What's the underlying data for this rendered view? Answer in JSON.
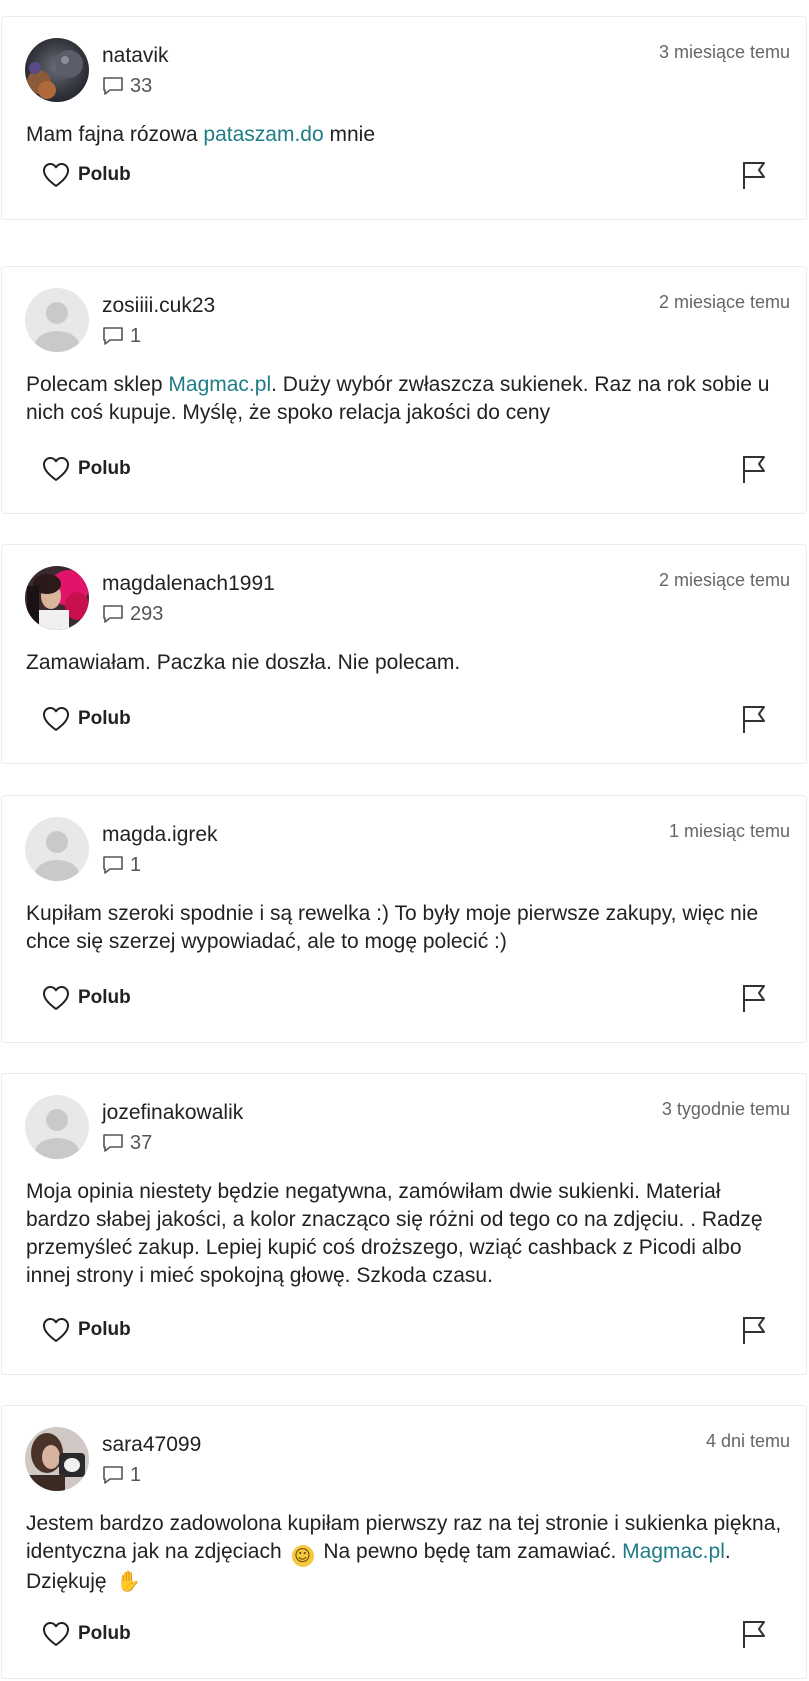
{
  "like_label": "Polub",
  "posts": [
    {
      "username": "natavik",
      "comment_count": "33",
      "time": "3 miesiące temu",
      "avatar": "photo",
      "text_before": "Mam fajna rózowa ",
      "link": "pataszam.do",
      "text_after": " mnie"
    },
    {
      "username": "zosiiii.cuk23",
      "comment_count": "1",
      "time": "2 miesiące temu",
      "avatar": "placeholder",
      "text_before": "Polecam sklep ",
      "link": "Magmac.pl",
      "text_after": ". Duży wybór zwłaszcza sukienek. Raz na rok sobie u nich coś kupuje. Myślę, że spoko relacja jakości do ceny"
    },
    {
      "username": "magdalenach1991",
      "comment_count": "293",
      "time": "2 miesiące temu",
      "avatar": "photo",
      "text": "Zamawiałam. Paczka nie doszła. Nie polecam."
    },
    {
      "username": "magda.igrek",
      "comment_count": "1",
      "time": "1 miesiąc temu",
      "avatar": "placeholder",
      "text": "Kupiłam szeroki spodnie i są rewelka :) To były moje pierwsze zakupy, więc nie chce się szerzej wypowiadać, ale to mogę polecić :)"
    },
    {
      "username": "jozefinakowalik",
      "comment_count": "37",
      "time": "3 tygodnie temu",
      "avatar": "placeholder",
      "text": "Moja opinia niestety będzie negatywna, zamówiłam dwie sukienki. Materiał bardzo słabej jakości, a kolor znacząco się różni od tego co na zdjęciu. . Radzę przemyśleć zakup. Lepiej kupić coś droższego, wziąć cashback z Picodi albo innej strony i mieć spokojną głowę. Szkoda czasu."
    },
    {
      "username": "sara47099",
      "comment_count": "1",
      "time": "4 dni temu",
      "avatar": "photo",
      "text_part1": "Jestem bardzo zadowolona kupiłam pierwszy raz na tej stronie i sukienka piękna, identyczna jak na zdjęciach",
      "emoji_smile": "🙂",
      "text_part2": " Na pewno będę tam zamawiać. ",
      "link": "Magmac.pl",
      "text_part3": ". Dziękuję",
      "emoji_thumb": "👍"
    }
  ],
  "icons": {
    "comment": "speech-bubble-icon",
    "like": "heart-icon",
    "report": "flag-icon",
    "avatar_placeholder": "user-silhouette-icon"
  },
  "colors": {
    "link": "#1e7c86",
    "text": "#222222",
    "muted": "#666666",
    "border": "#ececec",
    "placeholder_bg": "#e5e5e5",
    "placeholder_fg": "#c7c7c7"
  }
}
